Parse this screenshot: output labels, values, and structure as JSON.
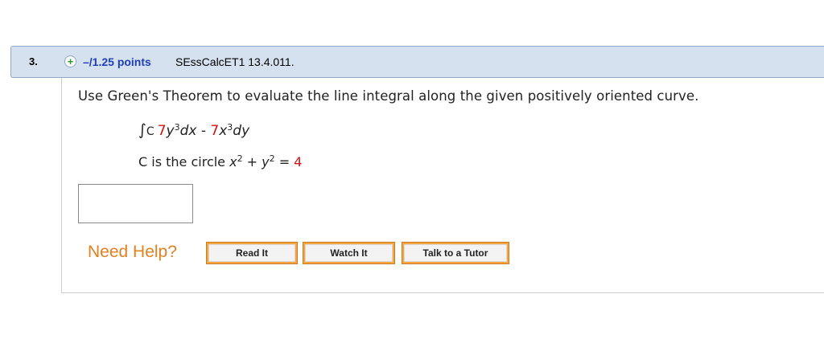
{
  "question": {
    "number": "3.",
    "points": "–/1.25 points",
    "source": "SEssCalcET1 13.4.011."
  },
  "prompt": "Use Green's Theorem to evaluate the line integral along the given positively oriented curve.",
  "integral": {
    "symbol": "∫",
    "subscript": "C",
    "coef1": "7",
    "term1": "y",
    "exp1": "3",
    "dx": "dx",
    "minus": " - ",
    "coef2": "7",
    "term2": "x",
    "exp2": "3",
    "dy": "dy"
  },
  "curve": {
    "prefix": "C is the circle ",
    "x": "x",
    "xexp": "2",
    "plus": " + ",
    "y": "y",
    "yexp": "2",
    "equals": " = ",
    "radius_sq": "4"
  },
  "answer": {
    "value": ""
  },
  "help": {
    "label": "Need Help?",
    "read_it": "Read It",
    "watch_it": "Watch It",
    "talk_tutor": "Talk to a Tutor"
  },
  "colors": {
    "points_blue": "#1f3fb5",
    "red_value": "#d11010",
    "help_orange": "#e47f1e"
  }
}
